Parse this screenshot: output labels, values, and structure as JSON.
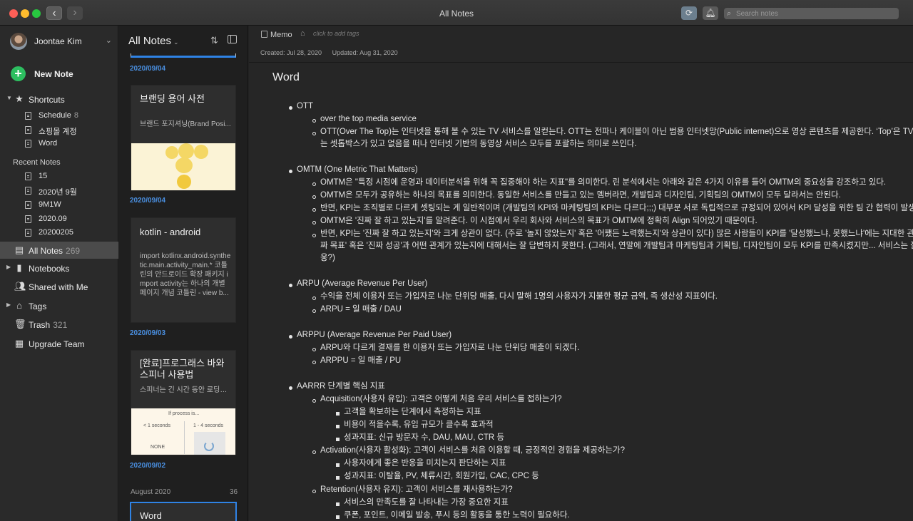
{
  "window": {
    "title": "All Notes",
    "search_placeholder": "Search notes"
  },
  "sidebar": {
    "user": "Joontae Kim",
    "new_note": "New Note",
    "shortcuts": {
      "label": "Shortcuts",
      "items": [
        {
          "label": "Schedule",
          "count": "8"
        },
        {
          "label": "쇼핑몰 계정",
          "count": ""
        },
        {
          "label": "Word",
          "count": ""
        }
      ]
    },
    "recent": {
      "label": "Recent Notes",
      "items": [
        {
          "label": "15"
        },
        {
          "label": "2020년 9월"
        },
        {
          "label": "9M1W"
        },
        {
          "label": "2020.09"
        },
        {
          "label": "20200205"
        }
      ]
    },
    "all_notes": {
      "label": "All Notes",
      "count": "269"
    },
    "notebooks": "Notebooks",
    "shared": "Shared with Me",
    "tags": "Tags",
    "trash": {
      "label": "Trash",
      "count": "321"
    },
    "upgrade": "Upgrade Team"
  },
  "notelist": {
    "title": "All Notes",
    "cards": [
      {
        "date": "2020/09/04",
        "title": "브랜딩 용어 사전",
        "snippet": "브랜드 포지셔닝(Brand Posi..."
      },
      {
        "date": "2020/09/04",
        "title": "kotlin - android",
        "snippet": "import kotlinx.android.synthetic.main.activity_main.* 코틀린의 안드로이드 확장 패키지 import activity는 하나의 개별 페이지 개념 코틀린 - view b..."
      },
      {
        "date": "2020/09/03",
        "title": "[완료]프로그래스 바와 스피너 사용법",
        "snippet": "스피너는 긴 시간 동안 로딩하...",
        "img": {
          "line1": "If process is...",
          "left": "< 1 seconds",
          "right": "1 - 4 seconds",
          "bottom": "NONE"
        }
      },
      {
        "date": "2020/09/02",
        "title": "",
        "snippet": ""
      }
    ],
    "month": {
      "label": "August 2020",
      "count": "36"
    },
    "selected": {
      "title": "Word"
    }
  },
  "editor": {
    "notebook": "Memo",
    "tags_placeholder": "click to add tags",
    "created": "Created: Jul 28, 2020",
    "updated": "Updated: Aug 31, 2020",
    "title": "Word",
    "lines": [
      "OTT",
      "over the top media service",
      "OTT(Over The Top)는 인터넷을 통해 볼 수 있는 TV 서비스를 일컫는다. OTT는 전파나 케이블이 아닌 범용 인터넷망(Public internet)으로 영상 콘텐츠를 제공한다. ‘Top’은 TV에 연결",
      "는 셋톱박스가 있고 없음을 떠나 인터넷 기반의 동영상 서비스 모두를 포괄하는 의미로 쓰인다.",
      "OMTM (One Metric That Matters)",
      "OMTM은 \"특정 시점에 운영과 데이터분석을 위해 꼭 집중해야 하는 지표\"를 의미한다.  린 분석에서는 아래와 같은 4가지 이유를 들어 OMTM의 중요성을 강조하고 있다.",
      "OMTM은 모두가 공유하는 하나의 목표를 의미한다.  동일한 서비스를 만들고 있는 멤버라면, 개발팀과 디자인팀, 기획팀의 OMTM이 모두 달라서는 안된다.",
      "반면, KPI는 조직별로 다르게 셋팅되는 게 일반적이며 (개발팀의 KPI와 마케팅팀의 KPI는 다르다;;;)  대부분 서로 독립적으로 규정되어 있어서 KPI 달성을 위한 팀 간 협력이 발생하기 어",
      "OMTM은 '진짜 잘 하고 있는지'를 알려준다.  이 시점에서 우리 회사와 서비스의 목표가 OMTM에 정확히 Align 되어있기 때문이다.",
      "반면, KPI는 '진짜 잘 하고 있는지'와 크게 상관이 없다. (주로 '놀지 않았는지' 혹은 '어쨌든 노력했는지'와 상관이 있다)  많은 사람들이 KPI를 '달성했느냐, 못했느냐'에는 지대한 관심이 있",
      "짜 목표' 혹은 '진짜 성공'과 어떤 관계가 있는지에 대해서는 잘 답변하지 못한다.  (그래서, 연말에 개발팀과 마케팅팀과 기획팀, 디자인팀이 모두 KPI를 만족시켰지만...  서비스는 잘 안 되",
      "웅?)",
      "ARPU (Average Revenue Per User)",
      "수익을 전체 이용자 또는 가입자로 나눈 단위당 매출, 다시 말해 1명의 사용자가 지불한 평균 금액, 즉 생산성 지표이다.",
      "ARPU = 일 매출 / DAU",
      "ARPPU (Average Revenue Per Paid User)",
      "ARPU와 다르게 결재를 한 이용자 또는 가입자로 나눈 단위당 매출이 되겠다.",
      "ARPPU = 일 매출 / PU",
      "AARRR 단계별 핵심 지표",
      "Acquisition(사용자 유입): 고객은 어떻게 처음 우리 서비스를 접하는가?",
      "고객을 확보하는 단계에서 측정하는 지표",
      "비용이 적을수록, 유입 규모가 클수록 효과적",
      "성과지표: 신규 방문자 수, DAU, MAU, CTR 등",
      "Activation(사용자 활성화): 고객이 서비스를 처음 이용할 때, 긍정적인 경험을 제공하는가?",
      "사용자에게 좋은 반응을 미치는지 판단하는 지표",
      "성과지표: 이탈율, PV, 체류시간, 회원가입, CAC, CPC 등",
      "Retention(사용자 유지): 고객이 서비스를 재사용하는가?",
      "서비스의 만족도를 잘 나타내는 가장 중요한 지표",
      "쿠폰, 포인트, 이메일 발송, 푸시 등의 활동을 통한 노력이 필요하다."
    ]
  }
}
